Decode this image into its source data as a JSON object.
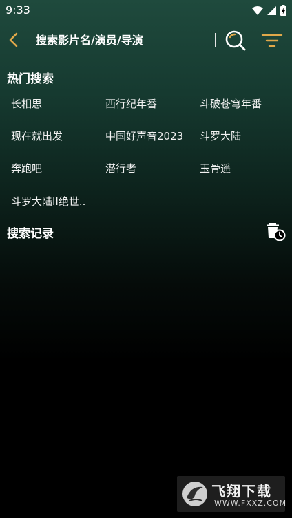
{
  "status_bar": {
    "time": "9:33"
  },
  "search": {
    "placeholder": "搜索影片名/演员/导演"
  },
  "hot_search": {
    "title": "热门搜索",
    "items": [
      "长相思",
      "西行纪年番",
      "斗破苍穹年番",
      "现在就出发",
      "中国好声音2023",
      "斗罗大陆",
      "奔跑吧",
      "潜行者",
      "玉骨遥",
      "斗罗大陆II绝世.."
    ]
  },
  "history": {
    "title": "搜索记录"
  },
  "watermark": {
    "title": "飞翔下载",
    "url": "WWW.FXXZ.COM"
  },
  "colors": {
    "accent": "#e0a84a",
    "background_top": "#1f4a3d",
    "background_bottom": "#000000"
  }
}
